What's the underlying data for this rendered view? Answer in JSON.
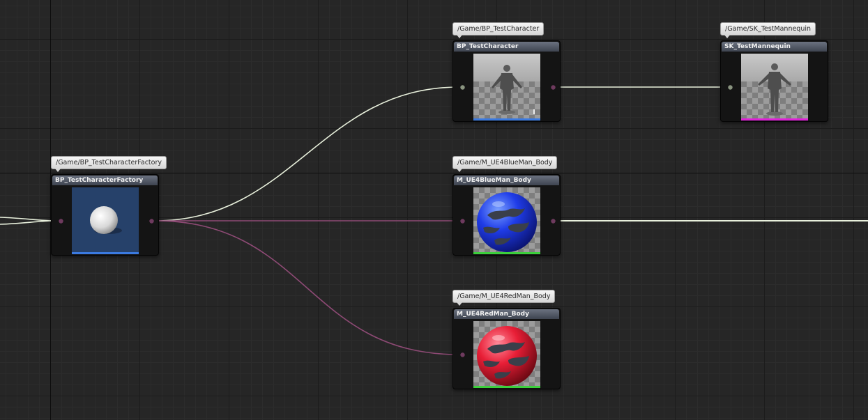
{
  "graph": {
    "nodes": [
      {
        "id": "factory",
        "title": "BP_TestCharacterFactory",
        "path": "/Game/BP_TestCharacterFactory",
        "thumbnail": "white-sphere-icon",
        "type_color": "#3b7ae0"
      },
      {
        "id": "character",
        "title": "BP_TestCharacter",
        "path": "/Game/BP_TestCharacter",
        "thumbnail": "mannequin-figure-icon",
        "type_color": "#3b7ae0"
      },
      {
        "id": "mannequin",
        "title": "SK_TestMannequin",
        "path": "/Game/SK_TestMannequin",
        "thumbnail": "mannequin-figure-icon",
        "type_color": "#e020d8"
      },
      {
        "id": "blue_body",
        "title": "M_UE4BlueMan_Body",
        "path": "/Game/M_UE4BlueMan_Body",
        "thumbnail": "blue-material-sphere-icon",
        "type_color": "#3ccf3c"
      },
      {
        "id": "red_body",
        "title": "M_UE4RedMan_Body",
        "path": "/Game/M_UE4RedMan_Body",
        "thumbnail": "red-material-sphere-icon",
        "type_color": "#3ccf3c"
      }
    ],
    "links": [
      {
        "from": "factory",
        "to": "character",
        "kind": "hard",
        "color": "#e8f0dc"
      },
      {
        "from": "character",
        "to": "mannequin",
        "kind": "hard",
        "color": "#e8f0dc"
      },
      {
        "from": "factory",
        "to": "blue_body",
        "kind": "soft",
        "color": "#8e4a75"
      },
      {
        "from": "factory",
        "to": "red_body",
        "kind": "soft",
        "color": "#8e4a75"
      }
    ],
    "colors": {
      "background": "#262626",
      "hard_reference": "#e8f0dc",
      "soft_reference": "#8e4a75"
    }
  }
}
